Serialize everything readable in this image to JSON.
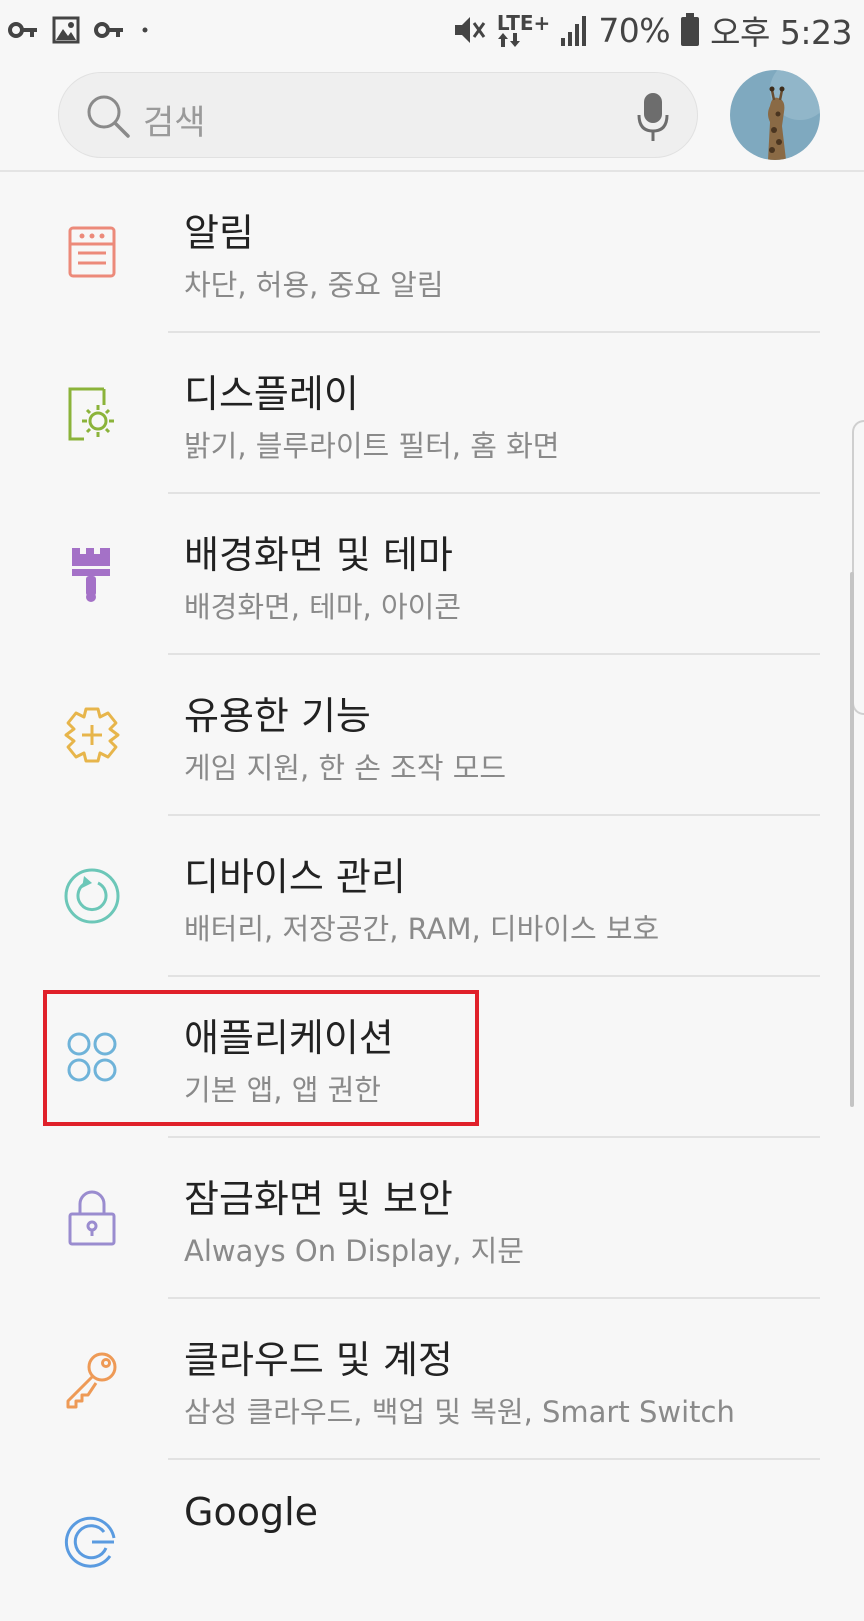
{
  "status_bar": {
    "left_icons": [
      "key-icon",
      "image-icon",
      "key-icon",
      "dot-icon"
    ],
    "network": "LTE+",
    "battery": "70%",
    "time": "오후 5:23"
  },
  "search": {
    "placeholder": "검색"
  },
  "settings": [
    {
      "title": "알림",
      "subtitle": "차단, 허용, 중요 알림",
      "icon": "notification-icon",
      "color": "#ec8a7a"
    },
    {
      "title": "디스플레이",
      "subtitle": "밝기, 블루라이트 필터, 홈 화면",
      "icon": "display-icon",
      "color": "#8bb33a"
    },
    {
      "title": "배경화면 및 테마",
      "subtitle": "배경화면, 테마, 아이콘",
      "icon": "brush-icon",
      "color": "#a471c7"
    },
    {
      "title": "유용한 기능",
      "subtitle": "게임 지원, 한 손 조작 모드",
      "icon": "advanced-features-icon",
      "color": "#e7b54b"
    },
    {
      "title": "디바이스 관리",
      "subtitle": "배터리, 저장공간, RAM, 디바이스 보호",
      "icon": "device-maintenance-icon",
      "color": "#6cc7b8"
    },
    {
      "title": "애플리케이션",
      "subtitle": "기본 앱, 앱 권한",
      "icon": "apps-icon",
      "color": "#6fb3d9"
    },
    {
      "title": "잠금화면 및 보안",
      "subtitle": "Always On Display, 지문",
      "icon": "lock-icon",
      "color": "#9a8ccf"
    },
    {
      "title": "클라우드 및 계정",
      "subtitle": "삼성 클라우드, 백업 및 복원, Smart Switch",
      "icon": "key-icon",
      "color": "#ee9a56"
    },
    {
      "title": "Google",
      "subtitle": "",
      "icon": "google-icon",
      "color": "#5a9be0"
    }
  ]
}
